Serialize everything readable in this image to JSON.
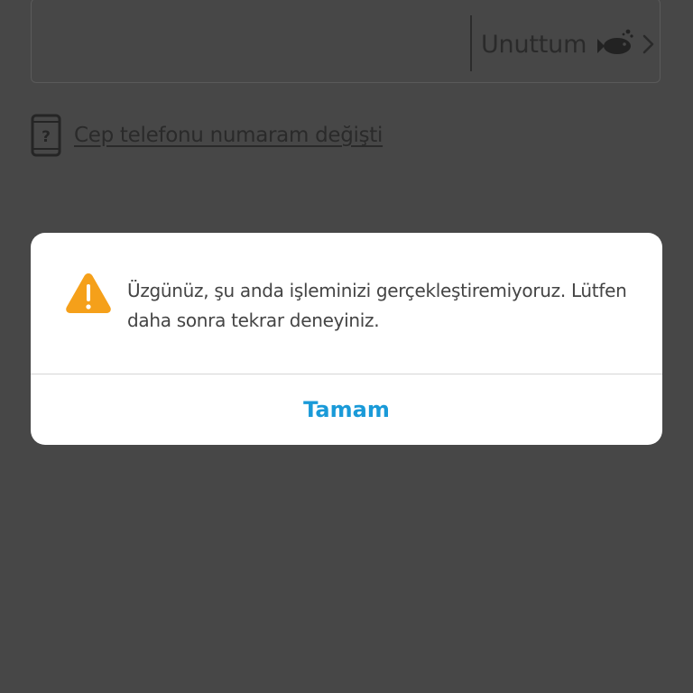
{
  "password_field": {
    "forgot_label": "Unuttum",
    "forgot_icon": "fish-icon",
    "chevron_icon": "chevron-right-icon"
  },
  "phone_link": {
    "icon": "phone-question-icon",
    "label": "Cep telefonu numaram değişti"
  },
  "dialog": {
    "icon": "warning-icon",
    "message": "Üzgünüz, şu anda işleminizi gerçekleştiremiyoruz. Lütfen daha sonra tekrar deneyiniz.",
    "button_label": "Tamam"
  },
  "colors": {
    "overlay_background": "#474747",
    "dialog_background": "#ffffff",
    "warning": "#f5a01a",
    "accent": "#1a9ad8",
    "message_text": "#444444"
  }
}
